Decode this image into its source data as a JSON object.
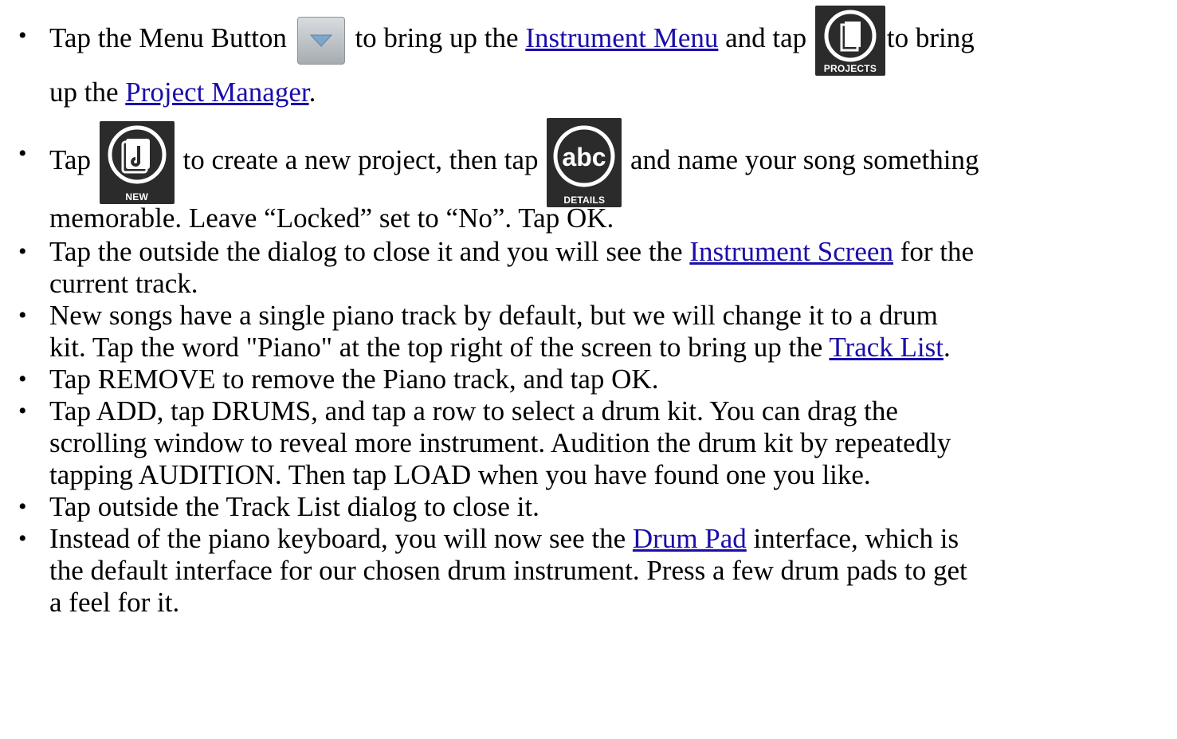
{
  "bullets": {
    "symbol": "•"
  },
  "step1": {
    "text_before_menu": "Tap the Menu Button",
    "menu_icon": "menu-triangle-icon",
    "text_after_menu": " to bring up the ",
    "link_instrument_menu": "Instrument Menu",
    "text_and_tap": " and tap ",
    "projects_icon": "projects-icon",
    "projects_label": "PROJECTS",
    "text_to_bring": "to bring",
    "text_up_the": "up the ",
    "link_project_manager": "Project Manager",
    "text_period": "."
  },
  "step2": {
    "text_tap": "Tap ",
    "new_icon": "new-project-icon",
    "new_label": "NEW",
    "text_create": " to create a new project, then tap ",
    "details_icon": "details-icon",
    "details_label": "DETAILS",
    "details_glyph": "abc",
    "text_name": " and name your song something",
    "text_line2": "memorable.  Leave “Locked” set to “No”. Tap OK."
  },
  "step3": {
    "text_before": "Tap the outside the dialog to close it and you will see the ",
    "link_instrument_screen": "Instrument Screen",
    "text_after": " for the",
    "text_line2": "current track."
  },
  "step4": {
    "text_line1": "New songs have a single piano track by default, but we will change it to a drum",
    "text_line2_before": "kit.  Tap the word \"Piano\" at the top right of the screen to bring up the ",
    "link_track_list": "Track List",
    "text_period": "."
  },
  "step5": {
    "text": "Tap REMOVE to remove the Piano track, and tap OK."
  },
  "step6": {
    "text_line1": "Tap ADD, tap DRUMS, and tap a row to select a drum kit.  You can drag the",
    "text_line2": "scrolling window to reveal more instrument. Audition the drum kit by repeatedly",
    "text_line3": "tapping AUDITION. Then tap LOAD when you have found one you like."
  },
  "step7": {
    "text": "Tap outside the Track List dialog to close it."
  },
  "step8": {
    "text_line1_before": "Instead of the piano keyboard, you will now see the ",
    "link_drum_pad": "Drum Pad",
    "text_line1_after": " interface, which is",
    "text_line2": "the default interface for our chosen drum instrument.  Press a few drum pads to get",
    "text_line3": "a feel for it."
  },
  "colors": {
    "link": "#1a0dab",
    "icon_tile": "#2b2b2b",
    "text": "#000000"
  }
}
